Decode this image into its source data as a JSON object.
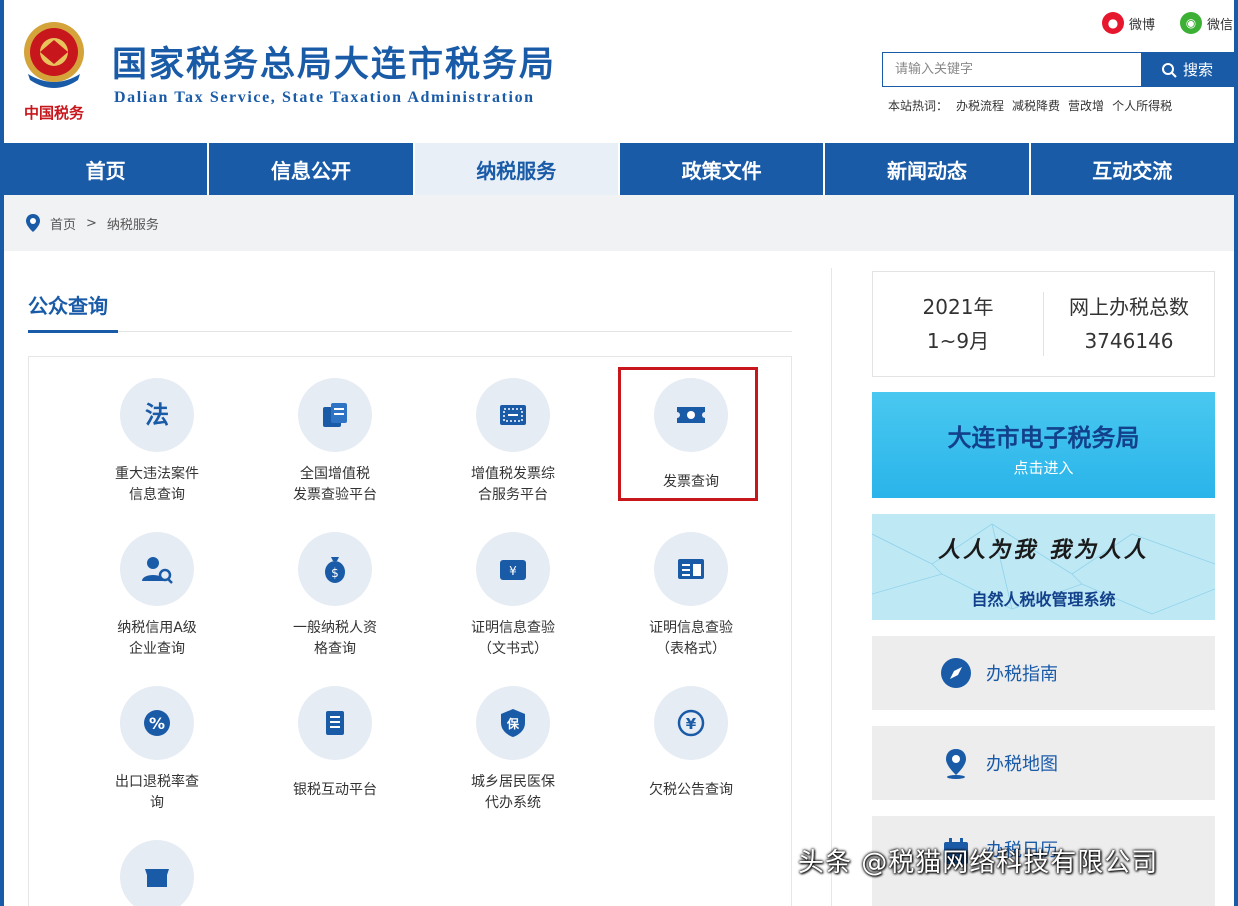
{
  "header": {
    "title": "国家税务总局大连市税务局",
    "subtitle": "Dalian Tax Service, State Taxation Administration",
    "emblem_text": "中国税务",
    "social": {
      "weibo": "微博",
      "wechat": "微信"
    },
    "search": {
      "placeholder": "请输入关键字",
      "button": "搜索"
    },
    "hot_label": "本站热词：",
    "hot_words": [
      "办税流程",
      "减税降费",
      "营改增",
      "个人所得税"
    ]
  },
  "nav": [
    "首页",
    "信息公开",
    "纳税服务",
    "政策文件",
    "新闻动态",
    "互动交流"
  ],
  "breadcrumb": {
    "home": "首页",
    "sep": ">",
    "current": "纳税服务"
  },
  "section": {
    "title": "公众查询"
  },
  "tiles": [
    {
      "label": "重大违法案件\n信息查询",
      "icon": "law-icon"
    },
    {
      "label": "全国增值税\n发票查验平台",
      "icon": "invoice-check-icon"
    },
    {
      "label": "增值税发票综\n合服务平台",
      "icon": "invoice-service-icon"
    },
    {
      "label": "发票查询",
      "icon": "ticket-icon"
    },
    {
      "label": "纳税信用A级\n企业查询",
      "icon": "credit-icon"
    },
    {
      "label": "一般纳税人资\n格查询",
      "icon": "qualification-icon"
    },
    {
      "label": "证明信息查验\n（文书式）",
      "icon": "certificate-doc-icon"
    },
    {
      "label": "证明信息查验\n（表格式）",
      "icon": "certificate-table-icon"
    },
    {
      "label": "出口退税率查\n询",
      "icon": "percent-icon"
    },
    {
      "label": "银税互动平台",
      "icon": "bank-icon"
    },
    {
      "label": "城乡居民医保\n代办系统",
      "icon": "insurance-icon"
    },
    {
      "label": "欠税公告查询",
      "icon": "yen-icon"
    },
    {
      "label": "",
      "icon": "store-icon"
    }
  ],
  "stats": {
    "year": "2021年",
    "months": "1~9月",
    "label": "网上办税总数",
    "value": "3746146"
  },
  "banners": {
    "etax_title": "大连市电子税务局",
    "etax_sub": "点击进入",
    "person_slogan": "人人为我 我为人人",
    "person_title": "自然人税收管理系统"
  },
  "services": [
    "办税指南",
    "办税地图",
    "办税日历"
  ],
  "watermark": "头条 @税猫网络科技有限公司",
  "colors": {
    "brand": "#1a5ba8",
    "highlight": "#c8161d",
    "weibo": "#e6162d",
    "wechat": "#3cb034"
  }
}
